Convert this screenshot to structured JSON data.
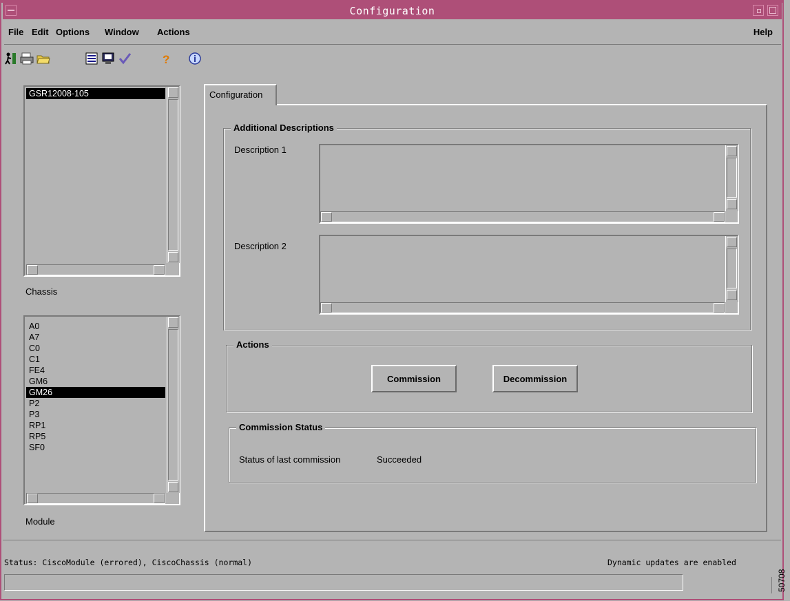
{
  "window": {
    "title": "Configuration"
  },
  "menu": {
    "file": "File",
    "edit": "Edit",
    "options": "Options",
    "window": "Window",
    "actions": "Actions",
    "help": "Help"
  },
  "toolbar": [
    "exit-icon",
    "print-icon",
    "open-folder-icon",
    "list-icon",
    "monitor-icon",
    "checkmark-icon",
    "help-icon",
    "info-icon"
  ],
  "chassis": {
    "label": "Chassis",
    "items": [
      "GSR12008-105"
    ],
    "selected": "GSR12008-105"
  },
  "module": {
    "label": "Module",
    "items": [
      "A0",
      "A7",
      "C0",
      "C1",
      "FE4",
      "GM6",
      "GM26",
      "P2",
      "P3",
      "RP1",
      "RP5",
      "SF0"
    ],
    "selected": "GM26"
  },
  "tab": {
    "label": "Configuration"
  },
  "descriptions": {
    "title": "Additional Descriptions",
    "desc1_label": "Description 1",
    "desc2_label": "Description 2",
    "desc1_value": "",
    "desc2_value": ""
  },
  "actions": {
    "title": "Actions",
    "commission": "Commission",
    "decommission": "Decommission"
  },
  "commission_status": {
    "title": "Commission Status",
    "label": "Status of last commission",
    "value": "Succeeded"
  },
  "statusbar": {
    "text": "Status: CiscoModule (errored), CiscoChassis (normal)",
    "updates": "Dynamic updates are enabled",
    "figure_id": "50708"
  },
  "colors": {
    "titlebar": "#ae4f78",
    "background": "#b4b4b4",
    "selection": "#000000"
  }
}
